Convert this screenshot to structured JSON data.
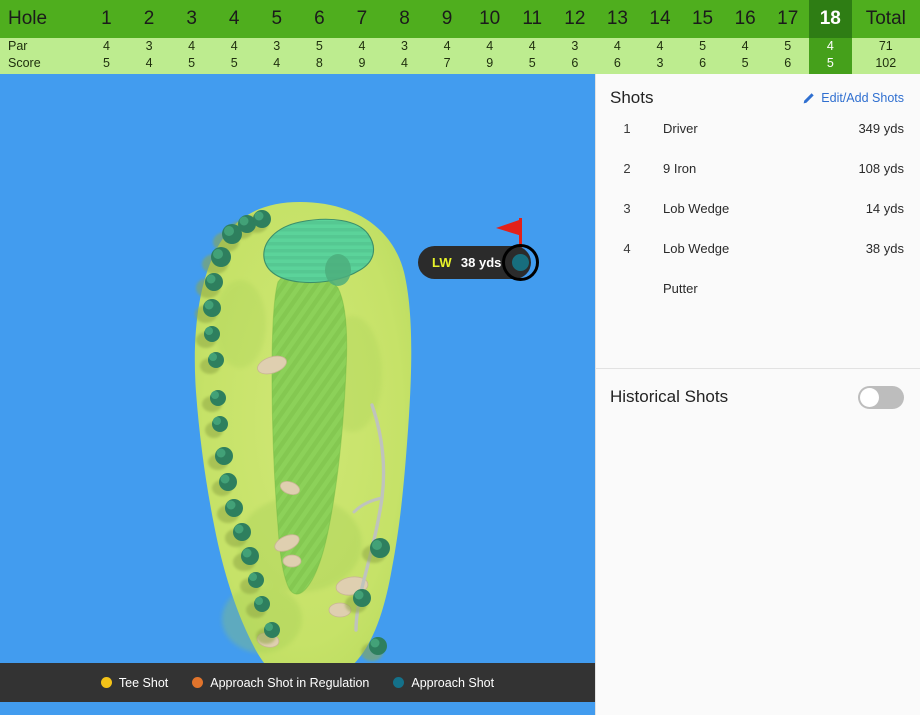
{
  "scorecard": {
    "label_hole": "Hole",
    "label_par": "Par",
    "label_score": "Score",
    "label_total": "Total",
    "holes": [
      "1",
      "2",
      "3",
      "4",
      "5",
      "6",
      "7",
      "8",
      "9",
      "10",
      "11",
      "12",
      "13",
      "14",
      "15",
      "16",
      "17",
      "18"
    ],
    "par": [
      "4",
      "3",
      "4",
      "4",
      "3",
      "5",
      "4",
      "3",
      "4",
      "4",
      "4",
      "3",
      "4",
      "4",
      "5",
      "4",
      "5",
      "4"
    ],
    "score": [
      "5",
      "4",
      "5",
      "5",
      "4",
      "8",
      "9",
      "4",
      "7",
      "9",
      "5",
      "6",
      "6",
      "3",
      "6",
      "5",
      "6",
      "5"
    ],
    "par_total": "71",
    "score_total": "102",
    "selected_hole_index": 17,
    "colors": {
      "header_green": "#4FAE1E",
      "row_green": "#BDEC8F",
      "header_selected": "#2E7D14",
      "row_selected": "#45A01B"
    }
  },
  "map": {
    "water_color": "#429CEF",
    "rough_color": "#C8E36B",
    "fairway_color": "#8CD159",
    "green_color": "#5BD39A",
    "bunker_color": "#DFCFB0",
    "tree_color": "#2E7F5E",
    "path_color": "#BFC3BD",
    "marker": {
      "club_abbr": "LW",
      "distance": "38 yds",
      "pin_color": "#e32119",
      "ball_color": "#176e7e"
    },
    "legend": [
      {
        "label": "Tee Shot",
        "color": "#F4C318"
      },
      {
        "label": "Approach Shot in Regulation",
        "color": "#E1742C"
      },
      {
        "label": "Approach Shot",
        "color": "#14718A"
      }
    ]
  },
  "shots_panel": {
    "title": "Shots",
    "edit_label": "Edit/Add Shots",
    "edit_icon": "pencil-icon",
    "rows": [
      {
        "num": "1",
        "club": "Driver",
        "distance": "349 yds"
      },
      {
        "num": "2",
        "club": "9 Iron",
        "distance": "108 yds"
      },
      {
        "num": "3",
        "club": "Lob Wedge",
        "distance": "14 yds"
      },
      {
        "num": "4",
        "club": "Lob Wedge",
        "distance": "38 yds"
      },
      {
        "num": "",
        "club": "Putter",
        "distance": ""
      }
    ]
  },
  "historical": {
    "title": "Historical Shots",
    "toggle_on": false
  }
}
